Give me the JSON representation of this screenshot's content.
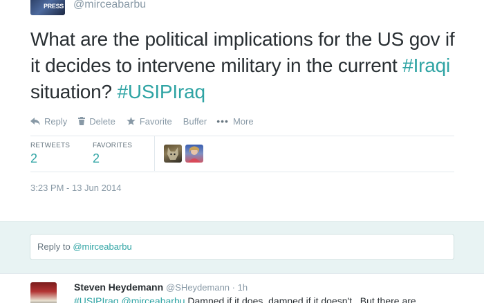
{
  "author": {
    "avatar_text": "PRESS",
    "handle": "@mirceabarbu"
  },
  "tweet": {
    "text_part1": "What are the political implications for the US gov if it decides to intervene military in the current ",
    "hashtag1": "#Iraqi",
    "text_part2": " situation? ",
    "hashtag2": "#USIPIraq"
  },
  "actions": {
    "reply": "Reply",
    "delete": "Delete",
    "favorite": "Favorite",
    "buffer": "Buffer",
    "more": "More"
  },
  "stats": {
    "retweets_label": "RETWEETS",
    "retweets_value": "2",
    "favorites_label": "FAVORITES",
    "favorites_value": "2"
  },
  "timestamp": "3:23 PM - 13 Jun 2014",
  "reply_box": {
    "prefix": "Reply to ",
    "mention": "@mirceabarbu"
  },
  "reply_tweet": {
    "name": "Steven Heydemann",
    "handle": "@SHeydemann",
    "time": "1h",
    "hashtag": "#USIPIraq",
    "mention": "@mirceabarbu",
    "text": " Damned if it does, damned if it doesn't.. But there are"
  },
  "colors": {
    "accent": "#2fa4a4",
    "muted": "#8899a6",
    "reply_bg": "#e8f3f3"
  }
}
